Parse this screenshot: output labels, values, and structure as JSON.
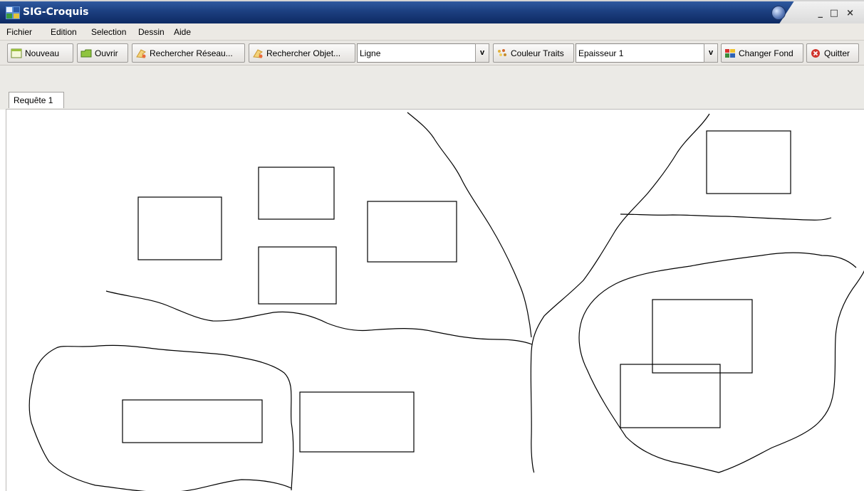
{
  "window": {
    "title": "SIG-Croquis",
    "controls": [
      "_",
      "□",
      "×"
    ]
  },
  "menu": {
    "items": [
      "Fichier",
      "Edition",
      "Selection",
      "Dessin",
      "Aide"
    ]
  },
  "toolbar": {
    "new_label": "Nouveau",
    "open_label": "Ouvrir",
    "search_network_label": "Rechercher Réseau...",
    "search_object_label": "Rechercher Objet...",
    "shape_select_value": "Ligne",
    "line_color_label": "Couleur Traits",
    "thickness_select_value": "Epaisseur 1",
    "change_background_label": "Changer Fond",
    "quit_label": "Quitter",
    "dropdown_arrow": "v"
  },
  "tabs": [
    {
      "label": "Requête 1",
      "active": true
    }
  ],
  "icons": {
    "app": "sig-app-icon",
    "new": "new-document-icon",
    "open": "open-folder-icon",
    "search_network": "search-network-icon",
    "search_object": "search-object-icon",
    "line_color": "color-palette-icon",
    "change_background": "background-icon",
    "quit": "quit-icon"
  },
  "colors": {
    "titlebar": "#1c3f80",
    "stroke": "#000000",
    "quit_icon": "#d0342c"
  }
}
